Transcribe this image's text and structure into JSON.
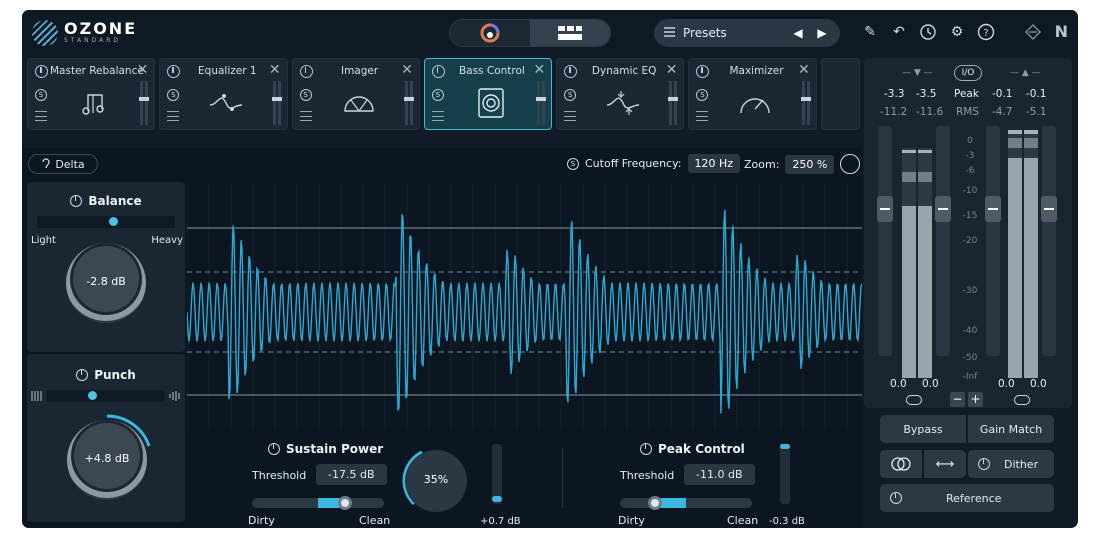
{
  "header": {
    "logo_name": "OZONE",
    "logo_sub": "STANDARD",
    "presets_label": "Presets",
    "ni_logo": "N"
  },
  "modules": [
    {
      "name": "Master Rebalance",
      "icon": "music-note-icon",
      "active": false
    },
    {
      "name": "Equalizer 1",
      "icon": "eq-curve-icon",
      "active": false
    },
    {
      "name": "Imager",
      "icon": "imager-fan-icon",
      "active": false
    },
    {
      "name": "Bass Control",
      "icon": "speaker-icon",
      "active": true
    },
    {
      "name": "Dynamic EQ",
      "icon": "dynamic-eq-icon",
      "active": false
    },
    {
      "name": "Maximizer",
      "icon": "gauge-icon",
      "active": false
    }
  ],
  "main": {
    "delta_label": "Delta",
    "cutoff_label": "Cutoff Frequency:",
    "cutoff_value": "120 Hz",
    "zoom_label": "Zoom:",
    "zoom_value": "250 %"
  },
  "balance": {
    "title": "Balance",
    "left_label": "Light",
    "right_label": "Heavy",
    "value": "-2.8 dB"
  },
  "punch": {
    "title": "Punch",
    "value": "+4.8 dB"
  },
  "sustain": {
    "title": "Sustain Power",
    "threshold_label": "Threshold",
    "threshold_value": "-17.5 dB",
    "left_label": "Dirty",
    "right_label": "Clean",
    "amount": "35%",
    "meter_value": "+0.7 dB"
  },
  "peak": {
    "title": "Peak Control",
    "threshold_label": "Threshold",
    "threshold_value": "-11.0 dB",
    "left_label": "Dirty",
    "right_label": "Clean",
    "meter_value": "-0.3 dB"
  },
  "meters": {
    "io_label": "I/O",
    "peak_label": "Peak",
    "rms_label": "RMS",
    "in_peak_l": "-3.3",
    "in_peak_r": "-3.5",
    "in_rms_l": "-11.2",
    "in_rms_r": "-11.6",
    "out_peak_l": "-0.1",
    "out_peak_r": "-0.1",
    "out_rms_l": "-4.7",
    "out_rms_r": "-5.1",
    "scale": [
      "0",
      "-3",
      "-6",
      "-10",
      "-15",
      "-20",
      "-30",
      "-40",
      "-50",
      "-Inf"
    ],
    "in_gain_l": "0.0",
    "in_gain_r": "0.0",
    "out_gain_l": "0.0",
    "out_gain_r": "0.0",
    "minus_label": "−",
    "plus_label": "+"
  },
  "buttons": {
    "bypass": "Bypass",
    "gain_match": "Gain Match",
    "dither": "Dither",
    "reference": "Reference"
  },
  "colors": {
    "accent": "#3bb8e0",
    "background": "#101b26",
    "waveform": "#2aa9d6"
  }
}
